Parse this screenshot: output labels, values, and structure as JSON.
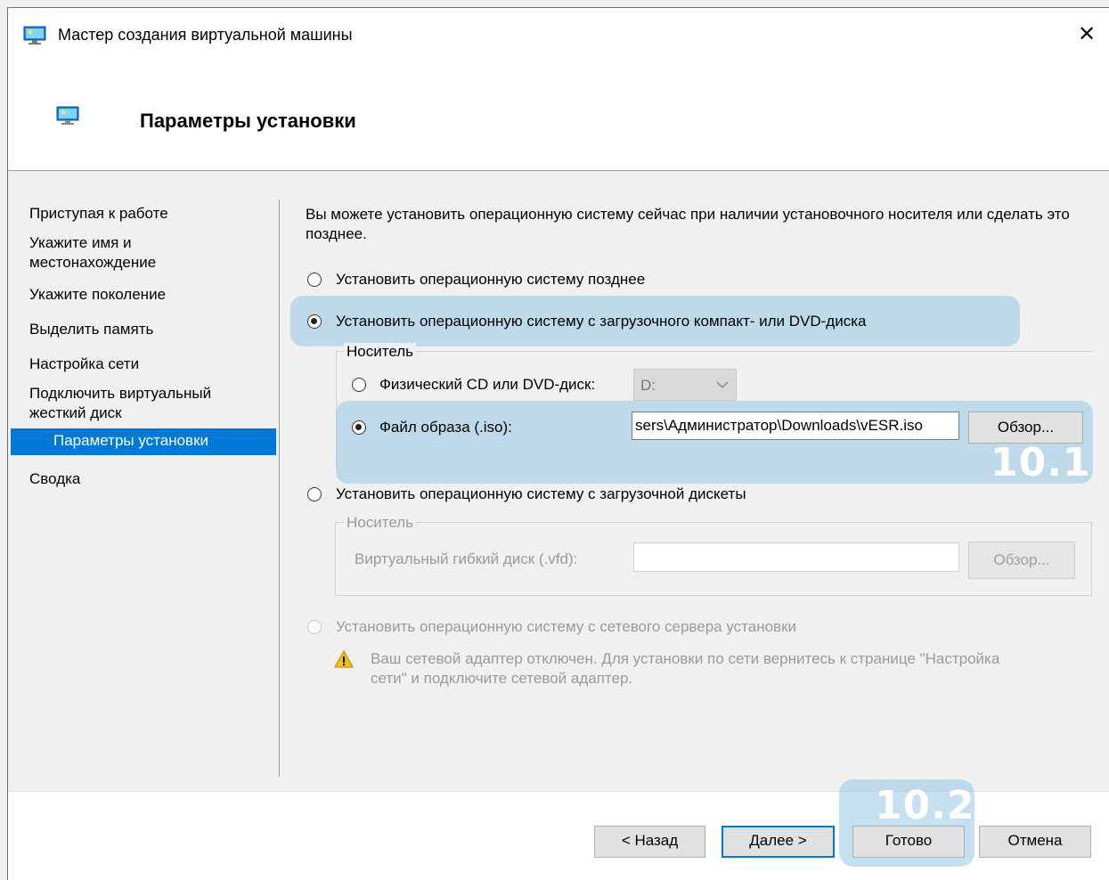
{
  "window": {
    "title": "Мастер создания виртуальной машины",
    "close_glyph": "✕",
    "app_icon": "hyperv-monitor-icon"
  },
  "header": {
    "title": "Параметры установки",
    "icon": "hyperv-monitor-icon"
  },
  "nav": {
    "items": [
      {
        "label": "Приступая к работе"
      },
      {
        "label": "Укажите имя и местонахождение"
      },
      {
        "label": "Укажите поколение"
      },
      {
        "label": "Выделить память"
      },
      {
        "label": "Настройка сети"
      },
      {
        "label": "Подключить виртуальный жесткий диск"
      },
      {
        "label": "Параметры установки",
        "selected": true
      },
      {
        "label": "Сводка"
      }
    ]
  },
  "main": {
    "intro": "Вы можете установить операционную систему сейчас при наличии установочного носителя или сделать это позднее.",
    "opt_later": "Установить операционную систему позднее",
    "opt_cd": "Установить операционную систему с загрузочного компакт- или DVD-диска",
    "cd_group_legend": "Носитель",
    "cd_physical_label": "Физический CD или DVD-диск:",
    "cd_drive_value": "D:",
    "cd_iso_label": "Файл образа (.iso):",
    "cd_iso_value": "sers\\Администратор\\Downloads\\vESR.iso",
    "browse_label": "Обзор...",
    "opt_floppy": "Установить операционную систему с загрузочной дискеты",
    "floppy_group_legend": "Носитель",
    "floppy_label": "Виртуальный гибкий диск (.vfd):",
    "floppy_value": "",
    "floppy_browse_label": "Обзор...",
    "opt_network": "Установить операционную систему с сетевого сервера установки",
    "network_warning": "Ваш сетевой адаптер отключен. Для установки по сети вернитесь к странице \"Настройка сети\" и подключите сетевой адаптер."
  },
  "annotations": {
    "badge1": "10.1",
    "badge2": "10.2",
    "highlight_color": "#96c8e6"
  },
  "footer": {
    "back": "< Назад",
    "next": "Далее >",
    "finish": "Готово",
    "cancel": "Отмена"
  },
  "colors": {
    "accent": "#0078d7",
    "selected_text": "#ffffff",
    "warning": "#f2c200"
  }
}
